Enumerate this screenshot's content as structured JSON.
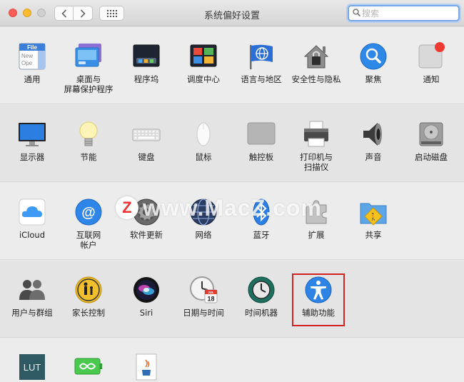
{
  "window": {
    "title": "系统偏好设置"
  },
  "search": {
    "placeholder": "搜索",
    "value": ""
  },
  "rows": [
    [
      {
        "id": "general",
        "label": [
          "通用"
        ],
        "icon": "general-icon"
      },
      {
        "id": "desktop",
        "label": [
          "桌面与",
          "屏幕保护程序"
        ],
        "icon": "desktop-screensaver-icon"
      },
      {
        "id": "dock",
        "label": [
          "程序坞"
        ],
        "icon": "dock-icon"
      },
      {
        "id": "mission",
        "label": [
          "调度中心"
        ],
        "icon": "mission-control-icon"
      },
      {
        "id": "language",
        "label": [
          "语言与地区"
        ],
        "icon": "language-region-icon"
      },
      {
        "id": "security",
        "label": [
          "安全性与隐私"
        ],
        "icon": "security-privacy-icon"
      },
      {
        "id": "spotlight",
        "label": [
          "聚焦"
        ],
        "icon": "spotlight-icon"
      },
      {
        "id": "notifications",
        "label": [
          "通知"
        ],
        "icon": "notifications-icon"
      }
    ],
    [
      {
        "id": "displays",
        "label": [
          "显示器"
        ],
        "icon": "displays-icon"
      },
      {
        "id": "energy",
        "label": [
          "节能"
        ],
        "icon": "energy-saver-icon"
      },
      {
        "id": "keyboard",
        "label": [
          "键盘"
        ],
        "icon": "keyboard-icon"
      },
      {
        "id": "mouse",
        "label": [
          "鼠标"
        ],
        "icon": "mouse-icon"
      },
      {
        "id": "trackpad",
        "label": [
          "触控板"
        ],
        "icon": "trackpad-icon"
      },
      {
        "id": "printers",
        "label": [
          "打印机与",
          "扫描仪"
        ],
        "icon": "printer-icon"
      },
      {
        "id": "sound",
        "label": [
          "声音"
        ],
        "icon": "sound-icon"
      },
      {
        "id": "startup",
        "label": [
          "启动磁盘"
        ],
        "icon": "startup-disk-icon"
      }
    ],
    [
      {
        "id": "icloud",
        "label": [
          "iCloud"
        ],
        "icon": "icloud-icon"
      },
      {
        "id": "internet",
        "label": [
          "互联网",
          "帐户"
        ],
        "icon": "internet-accounts-icon"
      },
      {
        "id": "update",
        "label": [
          "软件更新"
        ],
        "icon": "software-update-icon"
      },
      {
        "id": "network",
        "label": [
          "网络"
        ],
        "icon": "network-icon"
      },
      {
        "id": "bluetooth",
        "label": [
          "蓝牙"
        ],
        "icon": "bluetooth-icon"
      },
      {
        "id": "extensions",
        "label": [
          "扩展"
        ],
        "icon": "extensions-icon"
      },
      {
        "id": "sharing",
        "label": [
          "共享"
        ],
        "icon": "sharing-icon"
      }
    ],
    [
      {
        "id": "users",
        "label": [
          "用户与群组"
        ],
        "icon": "users-groups-icon"
      },
      {
        "id": "parental",
        "label": [
          "家长控制"
        ],
        "icon": "parental-controls-icon"
      },
      {
        "id": "siri",
        "label": [
          "Siri"
        ],
        "icon": "siri-icon"
      },
      {
        "id": "datetime",
        "label": [
          "日期与时间"
        ],
        "icon": "date-time-icon"
      },
      {
        "id": "timemachine",
        "label": [
          "时间机器"
        ],
        "icon": "time-machine-icon"
      },
      {
        "id": "accessibility",
        "label": [
          "辅助功能"
        ],
        "icon": "accessibility-icon"
      }
    ],
    [
      {
        "id": "lut",
        "label": [],
        "icon": "lut-icon",
        "glyph": "LUT"
      },
      {
        "id": "battery-app",
        "label": [],
        "icon": "infinity-battery-icon"
      },
      {
        "id": "java",
        "label": [],
        "icon": "java-icon"
      }
    ]
  ],
  "calendar": {
    "month": "JUL",
    "day": "18"
  },
  "file_icon_lines": [
    "File",
    "New",
    "Ope"
  ],
  "watermark": {
    "badge": "Z",
    "text": "www.MacZ.com"
  },
  "colors": {
    "highlight": "#d22424",
    "accent": "#7aa7e8"
  }
}
